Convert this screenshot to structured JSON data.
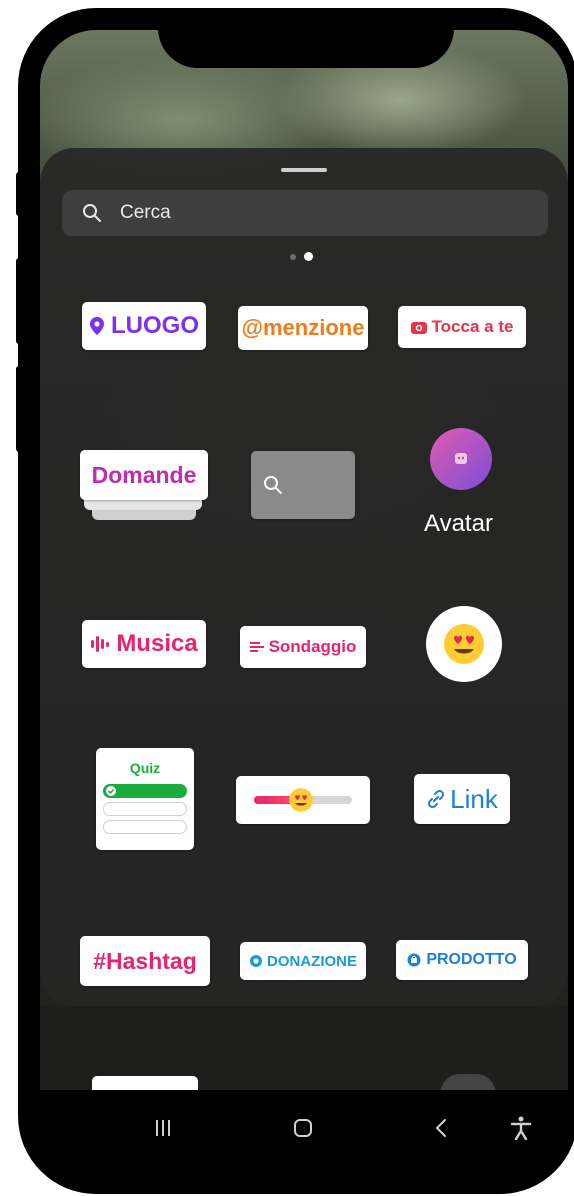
{
  "search": {
    "placeholder": "Cerca",
    "icon": "search-icon"
  },
  "pager": {
    "pages": 2,
    "active_index": 1
  },
  "stickers": {
    "luogo": "LUOGO",
    "menzione": "@menzione",
    "tocca": "Tocca a te",
    "domande": "Domande",
    "avatar": "Avatar",
    "musica": "Musica",
    "sondaggio": "Sondaggio",
    "quiz": "Quiz",
    "link": "Link",
    "hashtag": "#Hashtag",
    "donazione": "DONAZIONE",
    "prodotto": "PRODOTTO"
  },
  "colors": {
    "purple": "#7b2ff7",
    "orange": "#f07b1a",
    "red": "#e8344a",
    "magenta": "#c02bb0",
    "pink": "#e8246e",
    "green": "#1aad3c",
    "blue": "#1a7fe0",
    "teal": "#1a9bd7"
  },
  "navigation": {
    "icons": [
      "recent-apps-icon",
      "home-icon",
      "back-icon",
      "accessibility-icon"
    ]
  }
}
